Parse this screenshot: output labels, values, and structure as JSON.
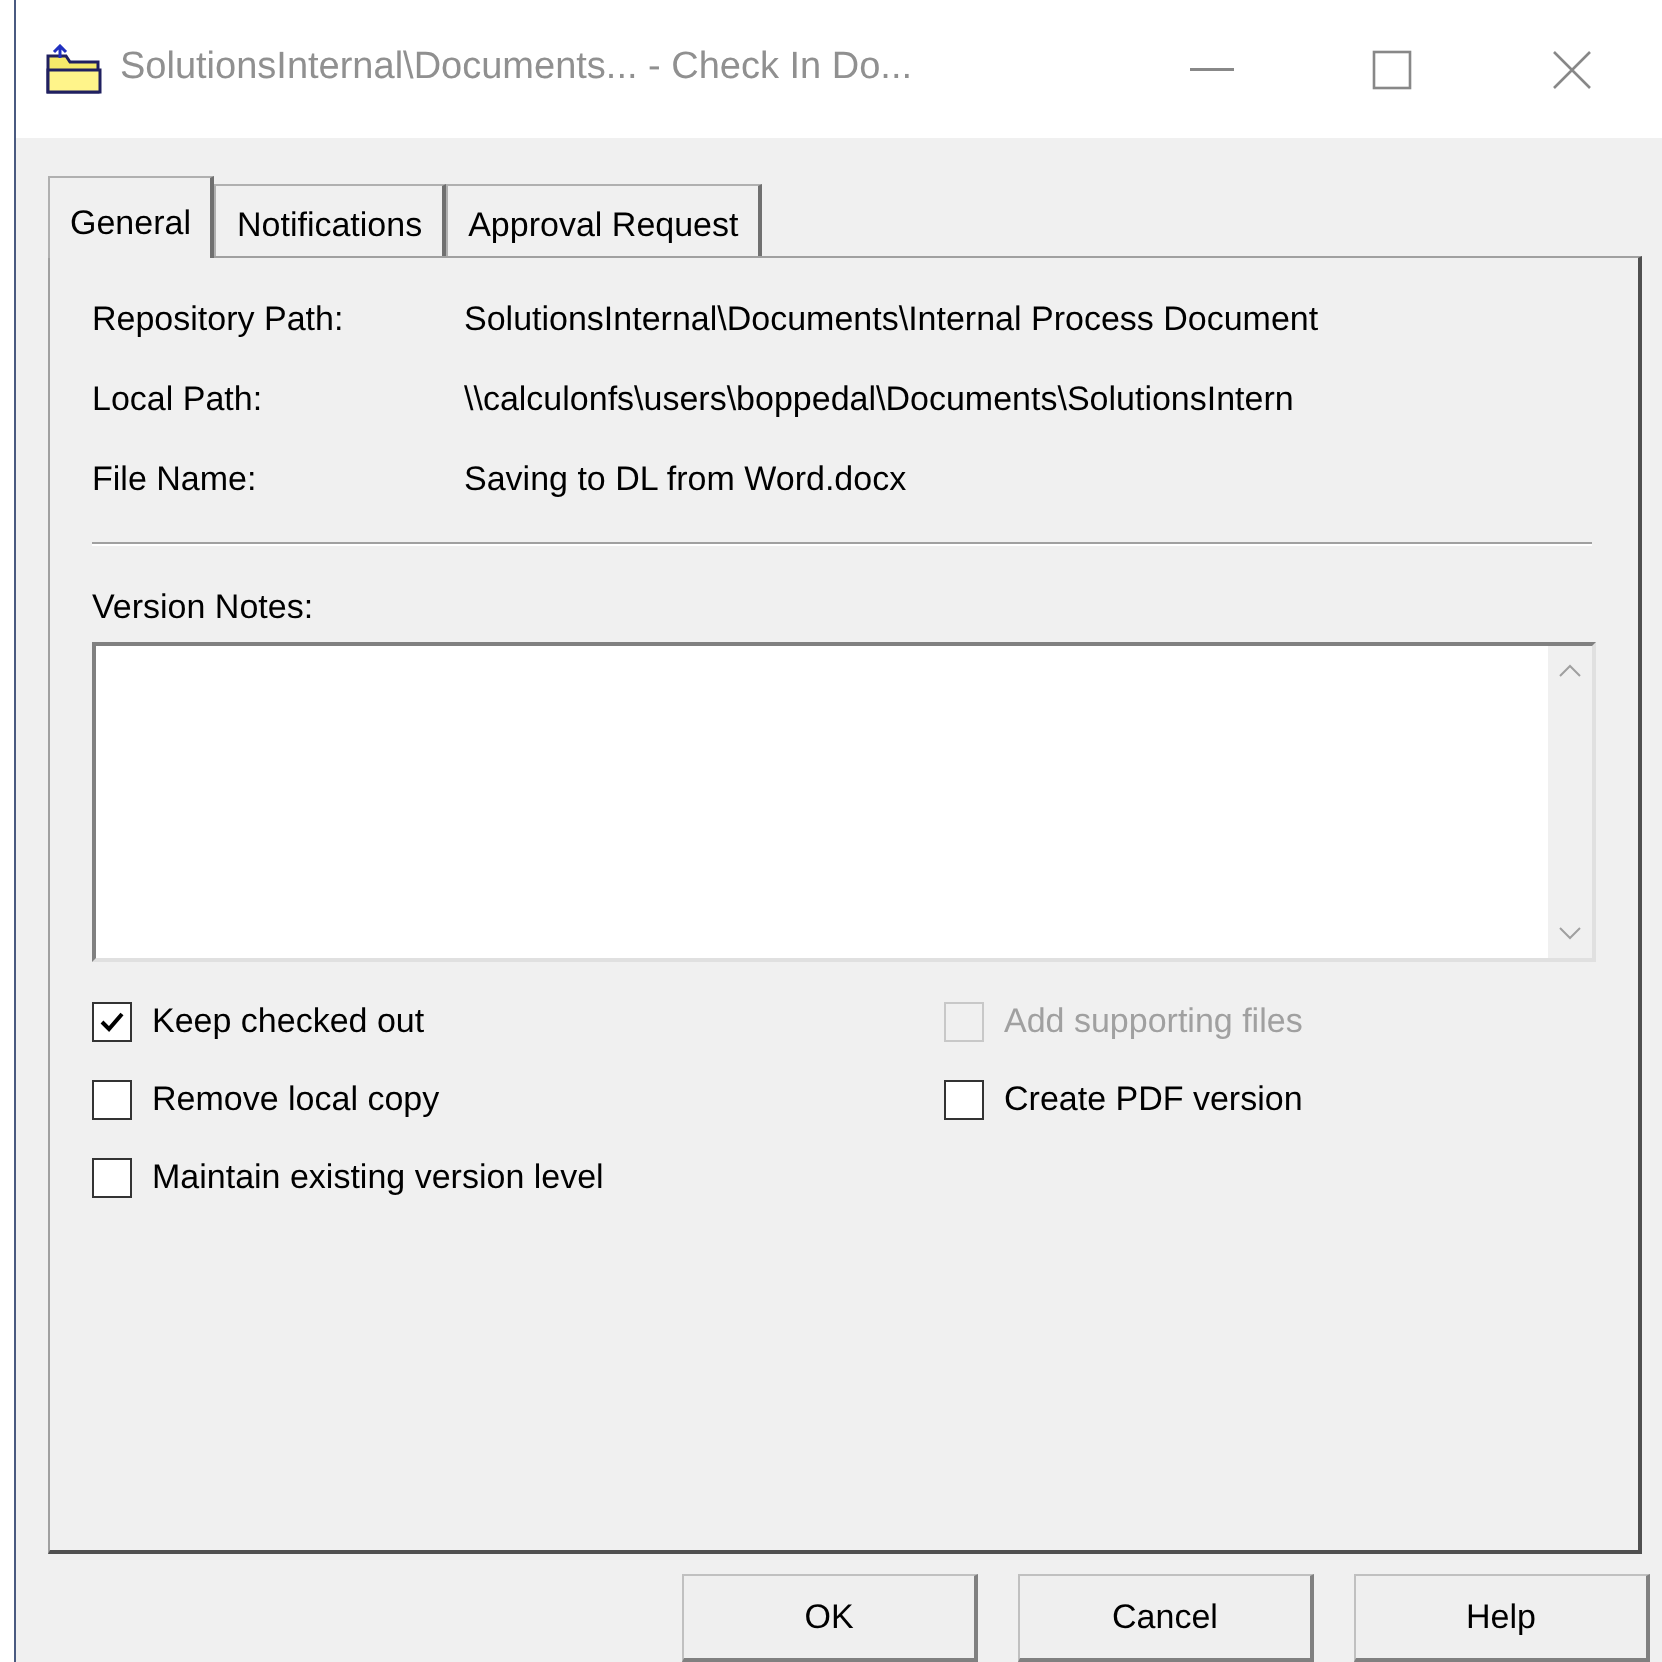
{
  "window": {
    "title": "SolutionsInternal\\Documents... - Check In Do..."
  },
  "tabs": [
    {
      "label": "General",
      "selected": true
    },
    {
      "label": "Notifications",
      "selected": false
    },
    {
      "label": "Approval Request",
      "selected": false
    }
  ],
  "fields": [
    {
      "label": "Repository Path:",
      "value": "SolutionsInternal\\Documents\\Internal Process Document"
    },
    {
      "label": "Local Path:",
      "value": "\\\\calculonfs\\users\\boppedal\\Documents\\SolutionsIntern"
    },
    {
      "label": "File Name:",
      "value": "Saving to DL from Word.docx"
    }
  ],
  "version_notes": {
    "label": "Version Notes:"
  },
  "options_left": [
    {
      "label": "Keep checked out",
      "checked": true,
      "disabled": false
    },
    {
      "label": "Remove local copy",
      "checked": false,
      "disabled": false
    },
    {
      "label": "Maintain existing version level",
      "checked": false,
      "disabled": false
    }
  ],
  "options_right": [
    {
      "label": "Add supporting files",
      "checked": false,
      "disabled": true
    },
    {
      "label": "Create PDF version",
      "checked": false,
      "disabled": false
    }
  ],
  "buttons": [
    "OK",
    "Cancel",
    "Help"
  ]
}
